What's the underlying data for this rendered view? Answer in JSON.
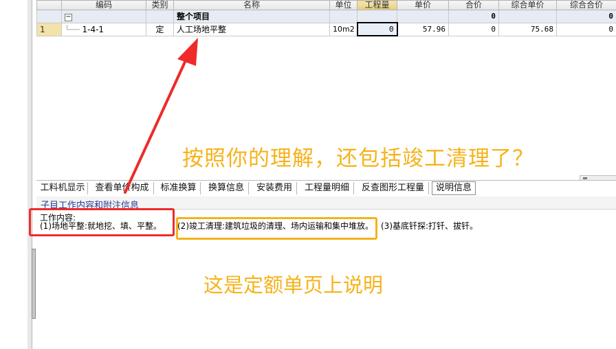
{
  "grid": {
    "columns": [
      "编码",
      "类别",
      "名称",
      "单位",
      "工程量",
      "单价",
      "合价",
      "综合单价",
      "综合合价"
    ],
    "group_row": {
      "name": "整个项目",
      "heji": "0",
      "zonghe_heji": "0"
    },
    "rows": [
      {
        "index": "1",
        "code": "1-4-1",
        "category": "定",
        "name": "人工场地平整",
        "unit": "10m2",
        "quantity": "0",
        "price": "57.96",
        "total": "0",
        "unit_total": "75.68",
        "sum_total": "0"
      }
    ]
  },
  "annotations": {
    "question": "按照你的理解，还包括竣工清理了？",
    "note": "这是定额单页上说明",
    "colors": {
      "yellow": "#f6b21a",
      "red": "#ee2a2a"
    }
  },
  "tabs": [
    {
      "label": "工料机显示"
    },
    {
      "label": "查看单价构成"
    },
    {
      "label": "标准换算"
    },
    {
      "label": "换算信息"
    },
    {
      "label": "安装费用"
    },
    {
      "label": "工程量明细"
    },
    {
      "label": "反查图形工程量"
    },
    {
      "label": "说明信息"
    }
  ],
  "subheader": "子目工作内容和附注信息",
  "work_content": {
    "label": "工作内容:",
    "part1": "(1)场地平整:就地挖、填、平整。",
    "part2": "(2)竣工清理:建筑垃圾的清理、场内运输和集中堆放。",
    "part3": "(3)基底钎探:打钎、拔钎。"
  }
}
